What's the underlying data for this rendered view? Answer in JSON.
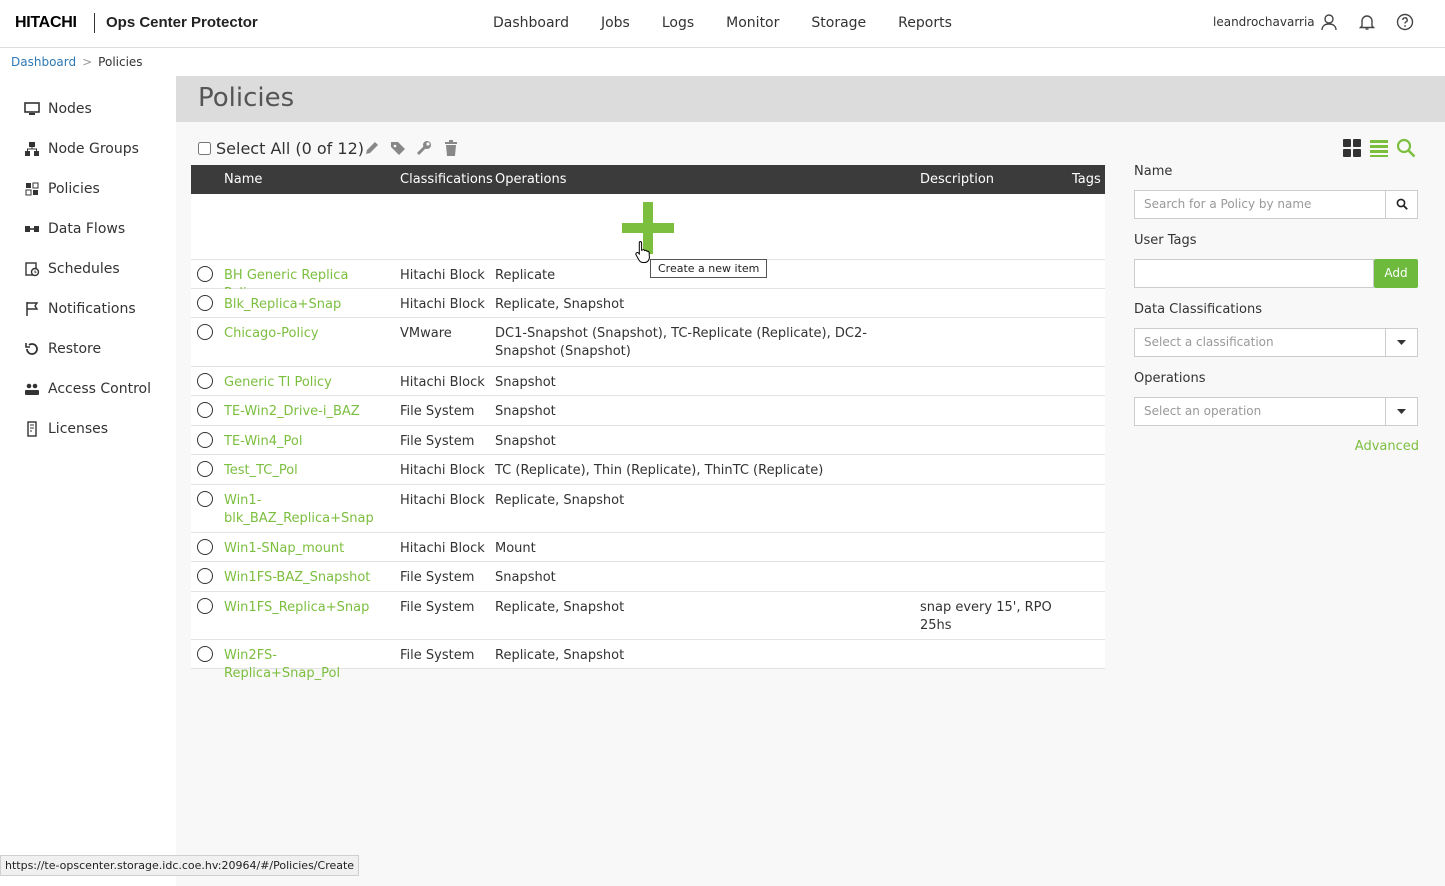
{
  "header": {
    "brand": "HITACHI",
    "product": "Ops Center Protector",
    "nav": [
      "Dashboard",
      "Jobs",
      "Logs",
      "Monitor",
      "Storage",
      "Reports"
    ],
    "username": "leandrochavarria",
    "icons": [
      "user-icon",
      "bell-icon",
      "help-icon"
    ]
  },
  "breadcrumb": {
    "link": "Dashboard",
    "separator": ">",
    "current": "Policies"
  },
  "sidebar": {
    "items": [
      {
        "label": "Nodes",
        "icon": "monitor-icon"
      },
      {
        "label": "Node Groups",
        "icon": "node-groups-icon"
      },
      {
        "label": "Policies",
        "icon": "policies-icon"
      },
      {
        "label": "Data Flows",
        "icon": "data-flows-icon"
      },
      {
        "label": "Schedules",
        "icon": "schedules-icon"
      },
      {
        "label": "Notifications",
        "icon": "flag-icon"
      },
      {
        "label": "Restore",
        "icon": "restore-icon"
      },
      {
        "label": "Access Control",
        "icon": "users-icon"
      },
      {
        "label": "Licenses",
        "icon": "license-icon"
      }
    ]
  },
  "page": {
    "title": "Policies"
  },
  "toolbar": {
    "select_all": "Select All (0 of 12)"
  },
  "table": {
    "columns": {
      "name": "Name",
      "classifications": "Classifications",
      "operations": "Operations",
      "description": "Description",
      "tags": "Tags"
    },
    "create_tooltip": "Create a new item",
    "rows": [
      {
        "name": "BH Generic Replica Policy",
        "classification": "Hitachi Block",
        "operations": "Replicate",
        "description": ""
      },
      {
        "name": "Blk_Replica+Snap",
        "classification": "Hitachi Block",
        "operations": "Replicate, Snapshot",
        "description": ""
      },
      {
        "name": "Chicago-Policy",
        "classification": "VMware",
        "operations": "DC1-Snapshot (Snapshot), TC-Replicate (Replicate), DC2-Snapshot (Snapshot)",
        "description": ""
      },
      {
        "name": "Generic TI Policy",
        "classification": "Hitachi Block",
        "operations": "Snapshot",
        "description": ""
      },
      {
        "name": "TE-Win2_Drive-i_BAZ",
        "classification": "File System",
        "operations": "Snapshot",
        "description": ""
      },
      {
        "name": "TE-Win4_Pol",
        "classification": "File System",
        "operations": "Snapshot",
        "description": ""
      },
      {
        "name": "Test_TC_Pol",
        "classification": "Hitachi Block",
        "operations": "TC (Replicate), Thin (Replicate), ThinTC (Replicate)",
        "description": ""
      },
      {
        "name": "Win1-blk_BAZ_Replica+Snap",
        "classification": "Hitachi Block",
        "operations": "Replicate, Snapshot",
        "description": ""
      },
      {
        "name": "Win1-SNap_mount",
        "classification": "Hitachi Block",
        "operations": "Mount",
        "description": ""
      },
      {
        "name": "Win1FS-BAZ_Snapshot",
        "classification": "File System",
        "operations": "Snapshot",
        "description": ""
      },
      {
        "name": "Win1FS_Replica+Snap",
        "classification": "File System",
        "operations": "Replicate, Snapshot",
        "description": "snap every 15', RPO 25hs"
      },
      {
        "name": "Win2FS-Replica+Snap_Pol",
        "classification": "File System",
        "operations": "Replicate, Snapshot",
        "description": ""
      }
    ]
  },
  "filters": {
    "name_label": "Name",
    "name_placeholder": "Search for a Policy by name",
    "tags_label": "User Tags",
    "tags_add": "Add",
    "classifications_label": "Data Classifications",
    "classifications_placeholder": "Select a classification",
    "operations_label": "Operations",
    "operations_placeholder": "Select an operation",
    "advanced": "Advanced"
  },
  "statusbar": {
    "url": "https://te-opscenter.storage.idc.coe.hv:20964/#/Policies/Create"
  },
  "colors": {
    "accent_green": "#7cbf3f",
    "header_dark": "#3b3b3b",
    "link_blue": "#2e78b6"
  }
}
